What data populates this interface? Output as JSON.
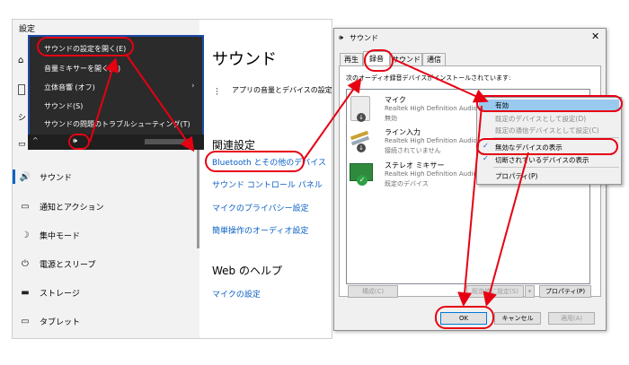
{
  "settings": {
    "title": "設定",
    "sidebar_items": [
      {
        "label": "サウンド",
        "icon": "🔊"
      },
      {
        "label": "通知とアクション",
        "icon": "▭"
      },
      {
        "label": "集中モード",
        "icon": "☽"
      },
      {
        "label": "電源とスリープ",
        "icon": "⏻"
      },
      {
        "label": "ストレージ",
        "icon": "▬"
      },
      {
        "label": "タブレット",
        "icon": "▭"
      }
    ],
    "main_title": "サウンド",
    "app_volume_text": "アプリの音量とデバイスの設定",
    "related_heading": "関連設定",
    "bluetooth_link": "Bluetooth とその他のデバイス",
    "sound_control_panel_link": "サウンド コントロール パネル",
    "mic_privacy_link": "マイクのプライバシー設定",
    "ease_audio_link": "簡単操作のオーディオ設定",
    "web_help_heading": "Web のヘルプ",
    "mic_setup_link": "マイクの設定"
  },
  "tray_menu": {
    "items": [
      "サウンドの設定を開く(E)",
      "音量ミキサーを開く(M)",
      "立体音響 (オフ)",
      "サウンド(S)",
      "サウンドの問題のトラブルシューティング(T)"
    ]
  },
  "dialog": {
    "title": "サウンド",
    "tabs": [
      "再生",
      "録音",
      "サウンド",
      "通信"
    ],
    "instruction": "次のオーディオ録音デバイスがインストールされています:",
    "devices": [
      {
        "name": "マイク",
        "driver": "Realtek High Definition Audio",
        "status": "無効"
      },
      {
        "name": "ライン入力",
        "driver": "Realtek High Definition Audio",
        "status": "接続されていません"
      },
      {
        "name": "ステレオ ミキサー",
        "driver": "Realtek High Definition Audio",
        "status": "既定のデバイス"
      }
    ],
    "configure_button": "構成(C)",
    "set_default_button": "既定値に設定(S)",
    "properties_button": "プロパティ(P)",
    "ok_button": "OK",
    "cancel_button": "キャンセル",
    "apply_button": "適用(A)"
  },
  "context_menu": {
    "items": [
      "有効",
      "既定のデバイスとして設定(D)",
      "既定の通信デバイスとして設定(C)",
      "無効なデバイスの表示",
      "切断されているデバイスの表示",
      "プロパティ(P)"
    ]
  },
  "colors": {
    "annotation": "#e60012",
    "link": "#0a5fc4",
    "highlight": "#99c9ef"
  }
}
